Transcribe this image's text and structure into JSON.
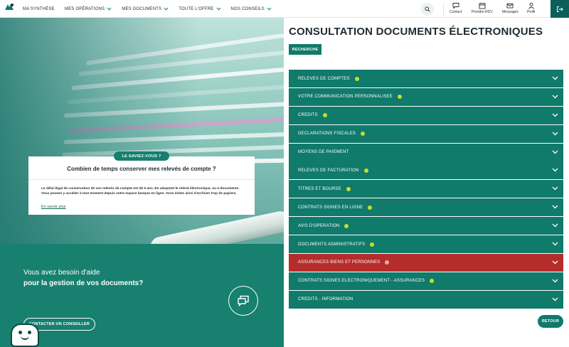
{
  "nav": {
    "items": [
      {
        "label": "MA SYNTHÈSE",
        "dropdown": false
      },
      {
        "label": "MES OPÉRATIONS",
        "dropdown": true
      },
      {
        "label": "MES DOCUMENTS",
        "dropdown": true
      },
      {
        "label": "TOUTE L'OFFRE",
        "dropdown": true
      },
      {
        "label": "NOS CONSEILS",
        "dropdown": true
      }
    ],
    "tools": {
      "contact": "Contact",
      "rdv": "Prendre RDV",
      "messages": "Messages",
      "profil": "Profil"
    }
  },
  "hero": {
    "badge": "LE SAVIEZ-VOUS ?",
    "title": "Combien de temps conserver mes relevés de compte ?",
    "text": "Le délai légal de conservation de vos relevés de compte est de 5 ans. En adoptant le relevé électronique, ou e-documents. Vous pouvez y accéder à tout moment depuis votre espace banque en ligne. Vous évitez ainsi d'archiver trop de papiers.",
    "link": "En savoir plus"
  },
  "help": {
    "line1": "Vous avez besoin d'aide",
    "line2": "pour la gestion de vos documents?",
    "contact_button": "CONTACTER UN CONSEILLER"
  },
  "main": {
    "title": "CONSULTATION DOCUMENTS ÉLECTRONIQUES",
    "search_label": "RECHERCHE",
    "sections": [
      {
        "label": "RELEVES DE COMPTES",
        "dot": true,
        "highlight": false
      },
      {
        "label": "VOTRE COMMUNICATION PERSONNALISEE",
        "dot": true,
        "highlight": false
      },
      {
        "label": "CREDITS",
        "dot": true,
        "highlight": false
      },
      {
        "label": "DECLARATIONS FISCALES",
        "dot": true,
        "highlight": false
      },
      {
        "label": "MOYENS DE PAIEMENT",
        "dot": false,
        "highlight": false
      },
      {
        "label": "RELEVES DE FACTURATION",
        "dot": true,
        "highlight": false
      },
      {
        "label": "TITRES ET BOURSE",
        "dot": true,
        "highlight": false
      },
      {
        "label": "CONTRATS SIGNES EN LIGNE",
        "dot": true,
        "highlight": false
      },
      {
        "label": "AVIS D'OPERATION",
        "dot": true,
        "highlight": false
      },
      {
        "label": "DOCUMENTS ADMINISTRATIFS",
        "dot": true,
        "highlight": false
      },
      {
        "label": "ASSURANCES BIENS ET PERSONNES",
        "dot": true,
        "highlight": true
      },
      {
        "label": "CONTRATS SIGNES ELECTRONIQUEMENT - ASSURANCES",
        "dot": true,
        "highlight": false
      },
      {
        "label": "CREDITS - INFORMATION",
        "dot": false,
        "highlight": false
      }
    ],
    "back_button": "RETOUR"
  },
  "colors": {
    "brand_green": "#107a6b",
    "highlight_red": "#b52d2b",
    "dot_green": "#c8dd27"
  }
}
